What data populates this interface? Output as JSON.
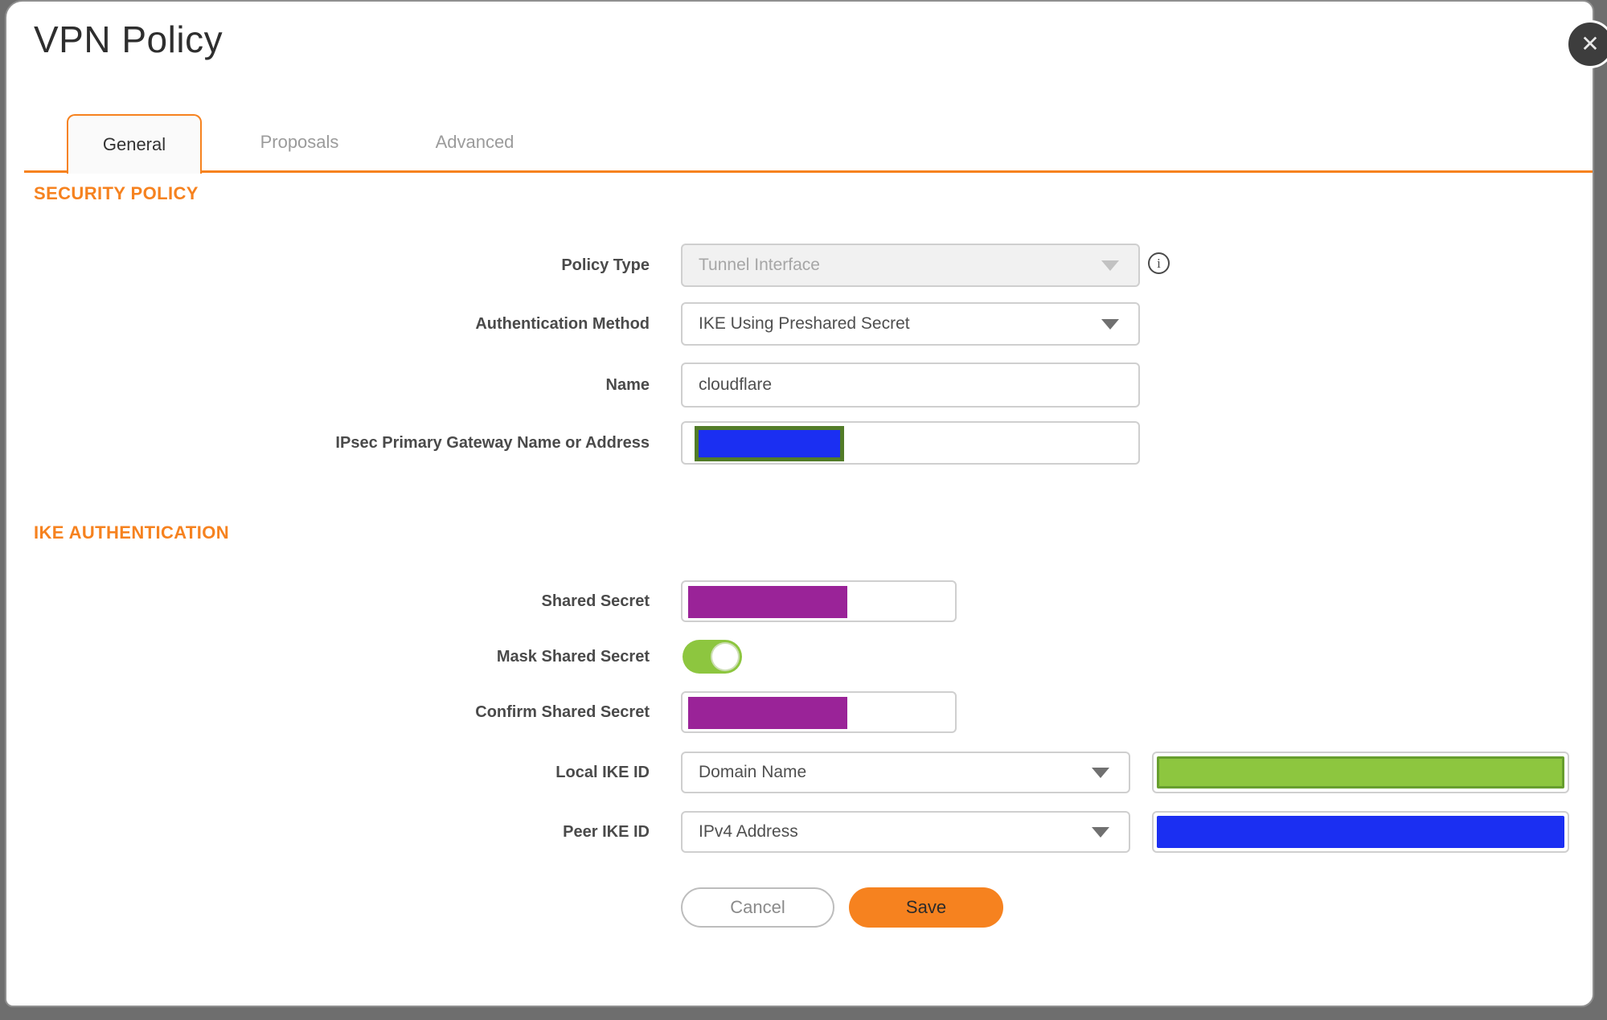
{
  "window": {
    "title": "VPN Policy"
  },
  "icons": {
    "close_glyph": "✕",
    "info_glyph": "i"
  },
  "tabs": [
    {
      "label": "General",
      "active": true
    },
    {
      "label": "Proposals",
      "active": false
    },
    {
      "label": "Advanced",
      "active": false
    }
  ],
  "security_policy": {
    "heading": "SECURITY POLICY",
    "policy_type": {
      "label": "Policy Type",
      "value": "Tunnel Interface",
      "disabled": true
    },
    "auth_method": {
      "label": "Authentication Method",
      "value": "IKE Using Preshared Secret"
    },
    "name": {
      "label": "Name",
      "value": "cloudflare"
    },
    "gateway": {
      "label": "IPsec Primary Gateway Name or Address",
      "value_redacted": "blue"
    }
  },
  "ike_authentication": {
    "heading": "IKE AUTHENTICATION",
    "shared_secret": {
      "label": "Shared Secret",
      "value_redacted": "purple"
    },
    "mask_shared_secret": {
      "label": "Mask Shared Secret",
      "state": "on"
    },
    "confirm_shared_secret": {
      "label": "Confirm Shared Secret",
      "value_redacted": "purple"
    },
    "local_ike_id": {
      "label": "Local IKE ID",
      "value": "Domain Name",
      "id_value_redacted": "green"
    },
    "peer_ike_id": {
      "label": "Peer IKE ID",
      "value": "IPv4 Address",
      "id_value_redacted": "blue"
    }
  },
  "actions": {
    "cancel": "Cancel",
    "save": "Save"
  },
  "colors": {
    "accent_orange": "#F6821F",
    "toggle_green": "#8DC63F",
    "redaction_green_fill": "#8DC63F",
    "redaction_green_border": "#679E2E",
    "redaction_blue": "#1B2FF2",
    "redaction_olive_border": "#527C28",
    "redaction_purple": "#9A2398",
    "scrim_grey": "#6E6E6E"
  }
}
